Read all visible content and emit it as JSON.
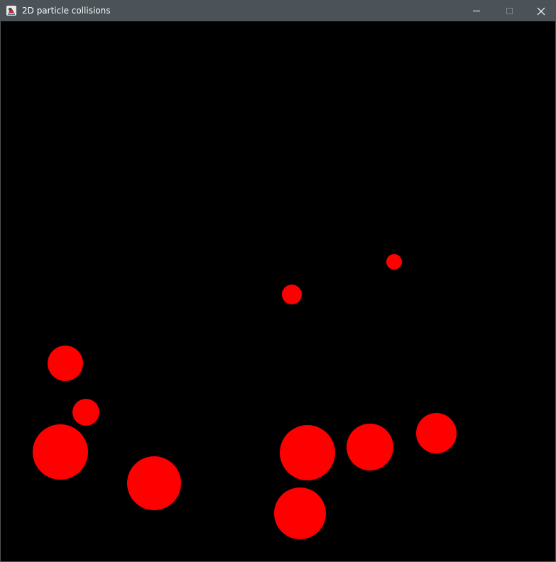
{
  "window": {
    "title": "2D particle collisions",
    "icons": {
      "app": "java-app-icon",
      "minimize": "minimize-icon",
      "maximize": "maximize-icon",
      "close": "close-icon"
    },
    "colors": {
      "titlebar": "#4b5358",
      "canvas": "#000000",
      "particle": "#ff0000"
    }
  }
}
